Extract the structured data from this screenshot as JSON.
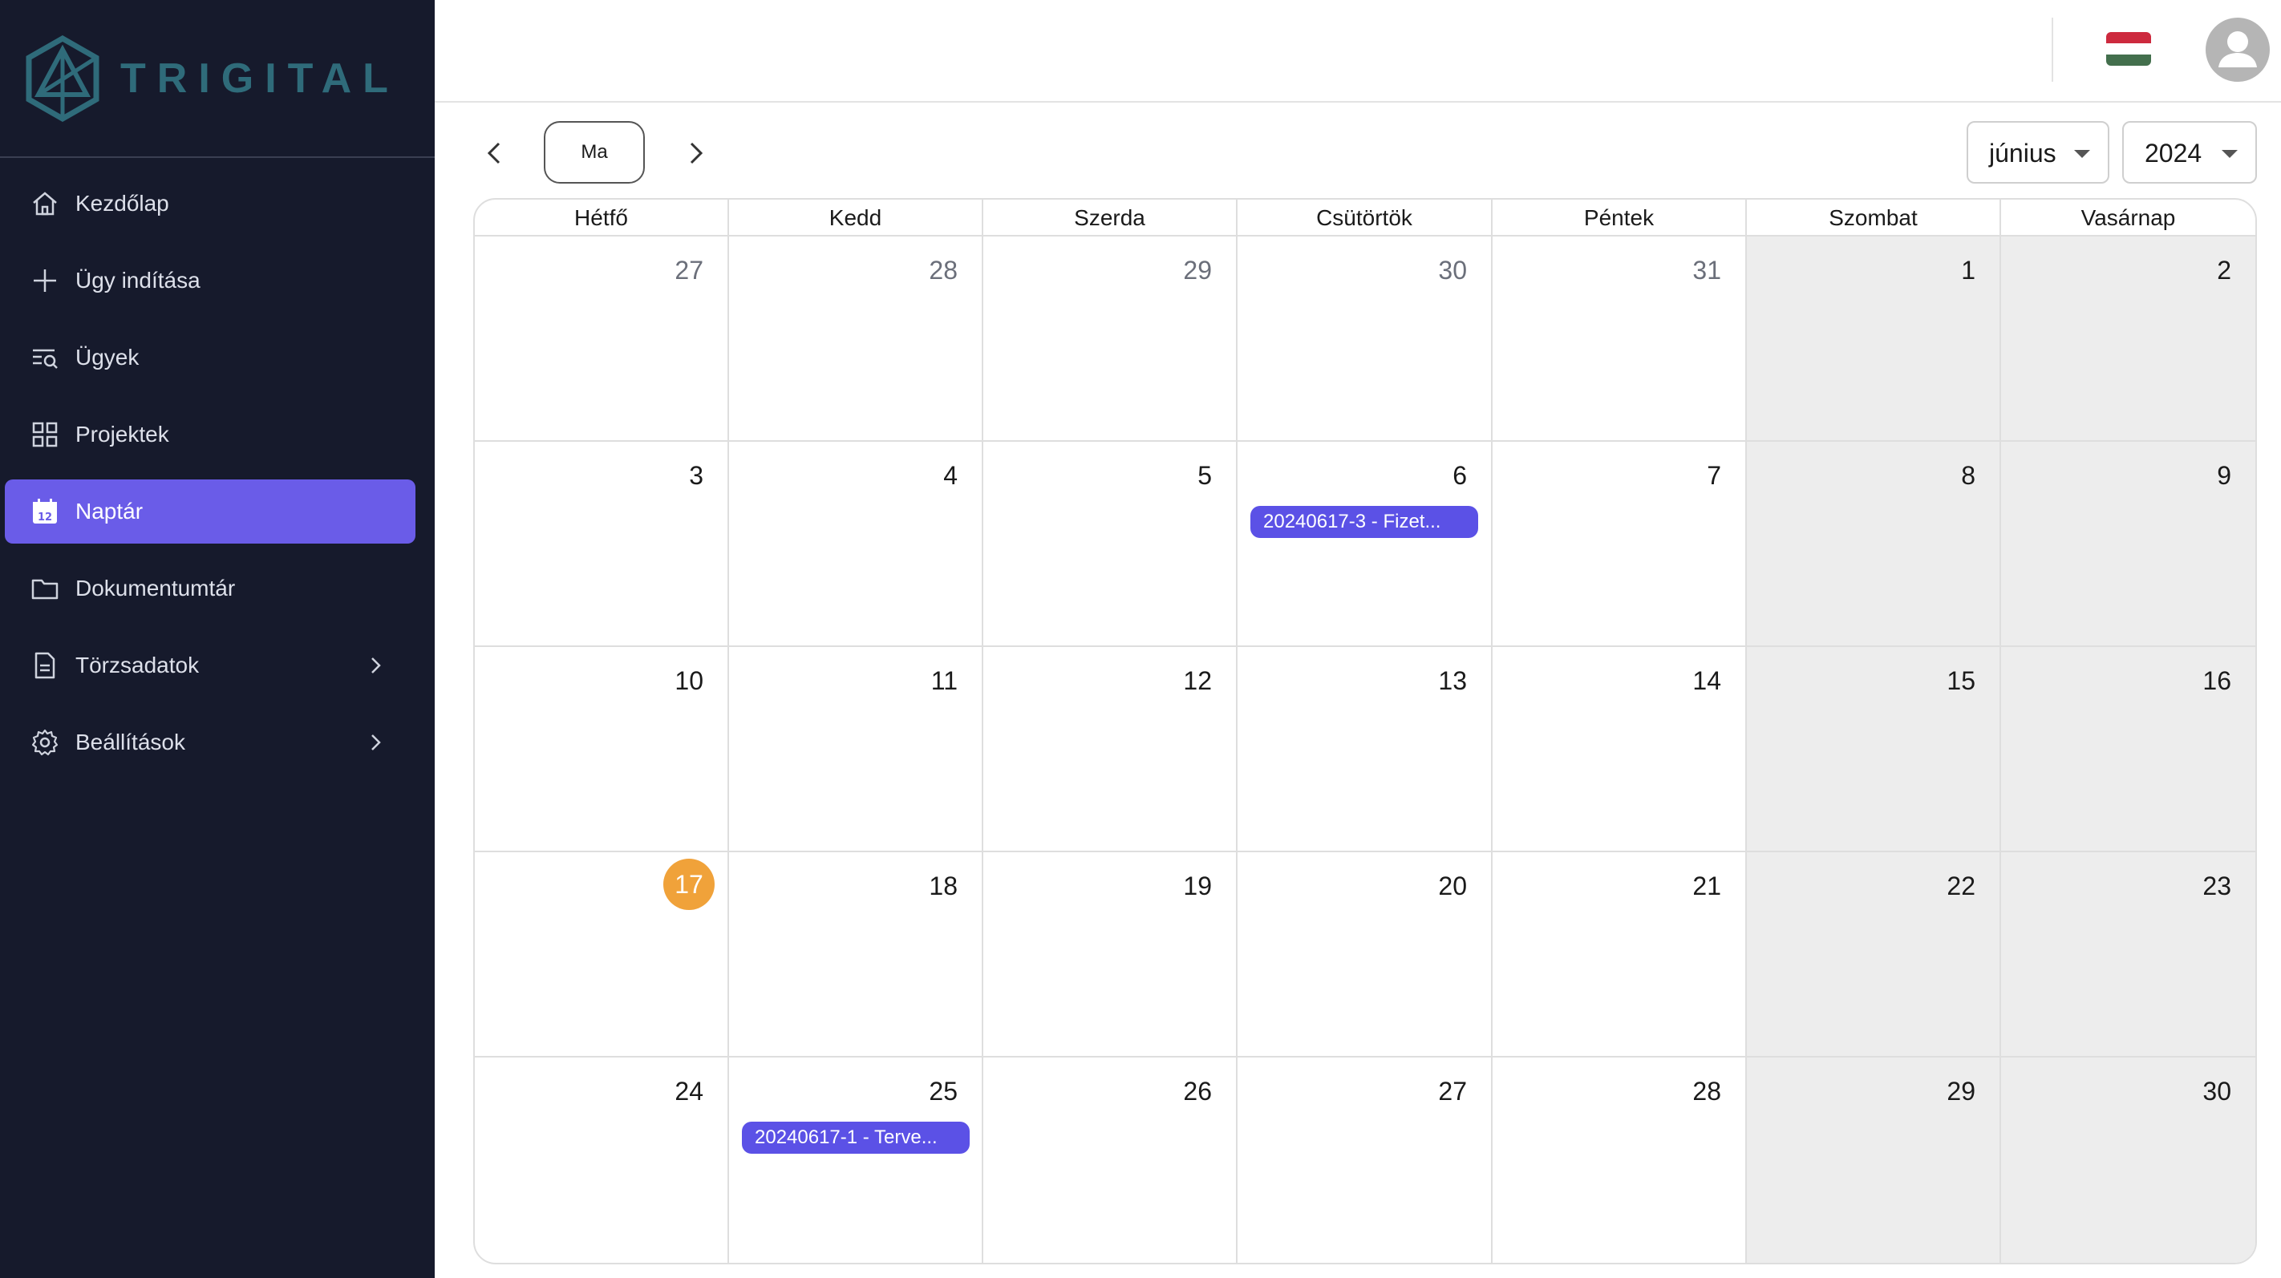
{
  "brand": {
    "name": "TRIGITAL"
  },
  "sidebar": {
    "items": [
      {
        "label": "Kezdőlap",
        "icon": "home-icon",
        "active": false
      },
      {
        "label": "Ügy indítása",
        "icon": "plus-icon",
        "active": false
      },
      {
        "label": "Ügyek",
        "icon": "search-list-icon",
        "active": false
      },
      {
        "label": "Projektek",
        "icon": "grid-icon",
        "active": false
      },
      {
        "label": "Naptár",
        "icon": "calendar-icon",
        "active": true
      },
      {
        "label": "Dokumentumtár",
        "icon": "folder-icon",
        "active": false
      },
      {
        "label": "Törzsadatok",
        "icon": "document-icon",
        "active": false,
        "expandable": true
      },
      {
        "label": "Beállítások",
        "icon": "gear-icon",
        "active": false,
        "expandable": true
      }
    ]
  },
  "toolbar": {
    "today_label": "Ma",
    "month": "június",
    "year": "2024"
  },
  "calendar": {
    "weekdays": [
      "Hétfő",
      "Kedd",
      "Szerda",
      "Csütörtök",
      "Péntek",
      "Szombat",
      "Vasárnap"
    ],
    "weeks": [
      [
        {
          "day": "27",
          "other": true
        },
        {
          "day": "28",
          "other": true
        },
        {
          "day": "29",
          "other": true
        },
        {
          "day": "30",
          "other": true
        },
        {
          "day": "31",
          "other": true
        },
        {
          "day": "1"
        },
        {
          "day": "2"
        }
      ],
      [
        {
          "day": "3"
        },
        {
          "day": "4"
        },
        {
          "day": "5"
        },
        {
          "day": "6",
          "event": "20240617-3 - Fizet..."
        },
        {
          "day": "7"
        },
        {
          "day": "8"
        },
        {
          "day": "9"
        }
      ],
      [
        {
          "day": "10"
        },
        {
          "day": "11"
        },
        {
          "day": "12"
        },
        {
          "day": "13"
        },
        {
          "day": "14"
        },
        {
          "day": "15"
        },
        {
          "day": "16"
        }
      ],
      [
        {
          "day": "17",
          "today": true
        },
        {
          "day": "18"
        },
        {
          "day": "19"
        },
        {
          "day": "20"
        },
        {
          "day": "21"
        },
        {
          "day": "22"
        },
        {
          "day": "23"
        }
      ],
      [
        {
          "day": "24"
        },
        {
          "day": "25",
          "event": "20240617-1 - Terve..."
        },
        {
          "day": "26"
        },
        {
          "day": "27"
        },
        {
          "day": "28"
        },
        {
          "day": "29"
        },
        {
          "day": "30"
        }
      ]
    ]
  },
  "colors": {
    "sidebar_bg": "#161a2c",
    "accent": "#6a5ce8",
    "event": "#5b51e6",
    "today": "#f0a23a",
    "weekend_bg": "#ededed"
  }
}
